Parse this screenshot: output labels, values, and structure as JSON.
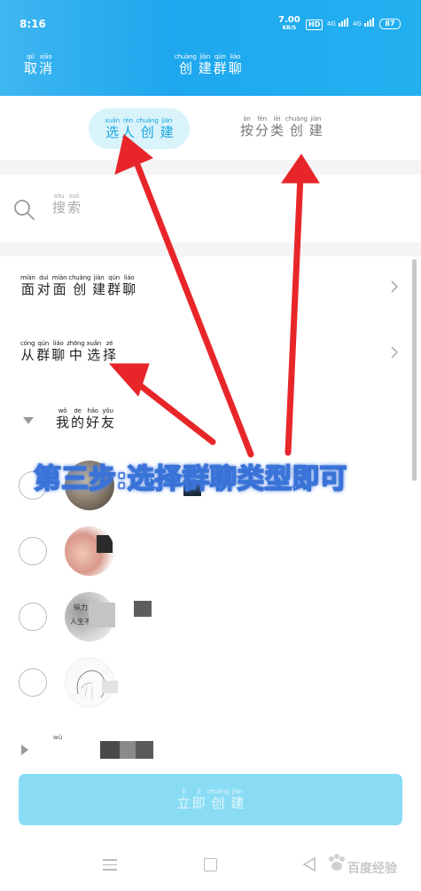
{
  "status_bar": {
    "time": "8:16",
    "net_speed": "7.00",
    "net_speed_unit": "KB/S",
    "hd_badge": "HD",
    "signal_1": "4G",
    "signal_2": "4G",
    "battery": "87"
  },
  "header": {
    "cancel": [
      {
        "py": "qǔ",
        "hz": "取"
      },
      {
        "py": "xiāo",
        "hz": "消"
      }
    ],
    "title": [
      {
        "py": "chuàng",
        "hz": "创"
      },
      {
        "py": "jiàn",
        "hz": "建"
      },
      {
        "py": "qún",
        "hz": "群"
      },
      {
        "py": "liáo",
        "hz": "聊"
      }
    ]
  },
  "tabs": {
    "select_person": [
      {
        "py": "xuǎn",
        "hz": "选"
      },
      {
        "py": "rén",
        "hz": "人"
      },
      {
        "py": "chuàng",
        "hz": "创"
      },
      {
        "py": "jiàn",
        "hz": "建"
      }
    ],
    "by_category": [
      {
        "py": "àn",
        "hz": "按"
      },
      {
        "py": "fēn",
        "hz": "分"
      },
      {
        "py": "lèi",
        "hz": "类"
      },
      {
        "py": "chuàng",
        "hz": "创"
      },
      {
        "py": "jiàn",
        "hz": "建"
      }
    ]
  },
  "search": {
    "placeholder": [
      {
        "py": "sōu",
        "hz": "搜"
      },
      {
        "py": "suǒ",
        "hz": "索"
      }
    ]
  },
  "list": {
    "face_to_face": [
      {
        "py": "miàn",
        "hz": "面"
      },
      {
        "py": "duì",
        "hz": "对"
      },
      {
        "py": "miàn",
        "hz": "面"
      },
      {
        "py": "chuàng",
        "hz": "创"
      },
      {
        "py": "jiàn",
        "hz": "建"
      },
      {
        "py": "qún",
        "hz": "群"
      },
      {
        "py": "liáo",
        "hz": "聊"
      }
    ],
    "from_group": [
      {
        "py": "cóng",
        "hz": "从"
      },
      {
        "py": "qún",
        "hz": "群"
      },
      {
        "py": "liáo",
        "hz": "聊"
      },
      {
        "py": "zhōng",
        "hz": "中"
      },
      {
        "py": "xuǎn",
        "hz": "选"
      },
      {
        "py": "zé",
        "hz": "择"
      }
    ],
    "my_friends": [
      {
        "py": "wǒ",
        "hz": "我"
      },
      {
        "py": "de",
        "hz": "的"
      },
      {
        "py": "hǎo",
        "hz": "好"
      },
      {
        "py": "yǒu",
        "hz": "友"
      }
    ],
    "avatar_3_text_1": "纵力",
    "avatar_3_text_2": "人生不",
    "group_row_text": "wǔ"
  },
  "banner": "第三步:选择群聊类型即可",
  "create_button": [
    {
      "py": "lì",
      "hz": "立"
    },
    {
      "py": "jí",
      "hz": "即"
    },
    {
      "py": "chuàng",
      "hz": "创"
    },
    {
      "py": "jiàn",
      "hz": "建"
    }
  ],
  "watermark": "百度经验",
  "colors": {
    "header_blue": "#1ea7ee",
    "tab_active_bg": "#d9f3fb",
    "tab_active_text": "#16a6de",
    "button_bg": "#8adcf5",
    "arrow_red": "#e8262a",
    "banner_stroke": "#3a73d8"
  }
}
